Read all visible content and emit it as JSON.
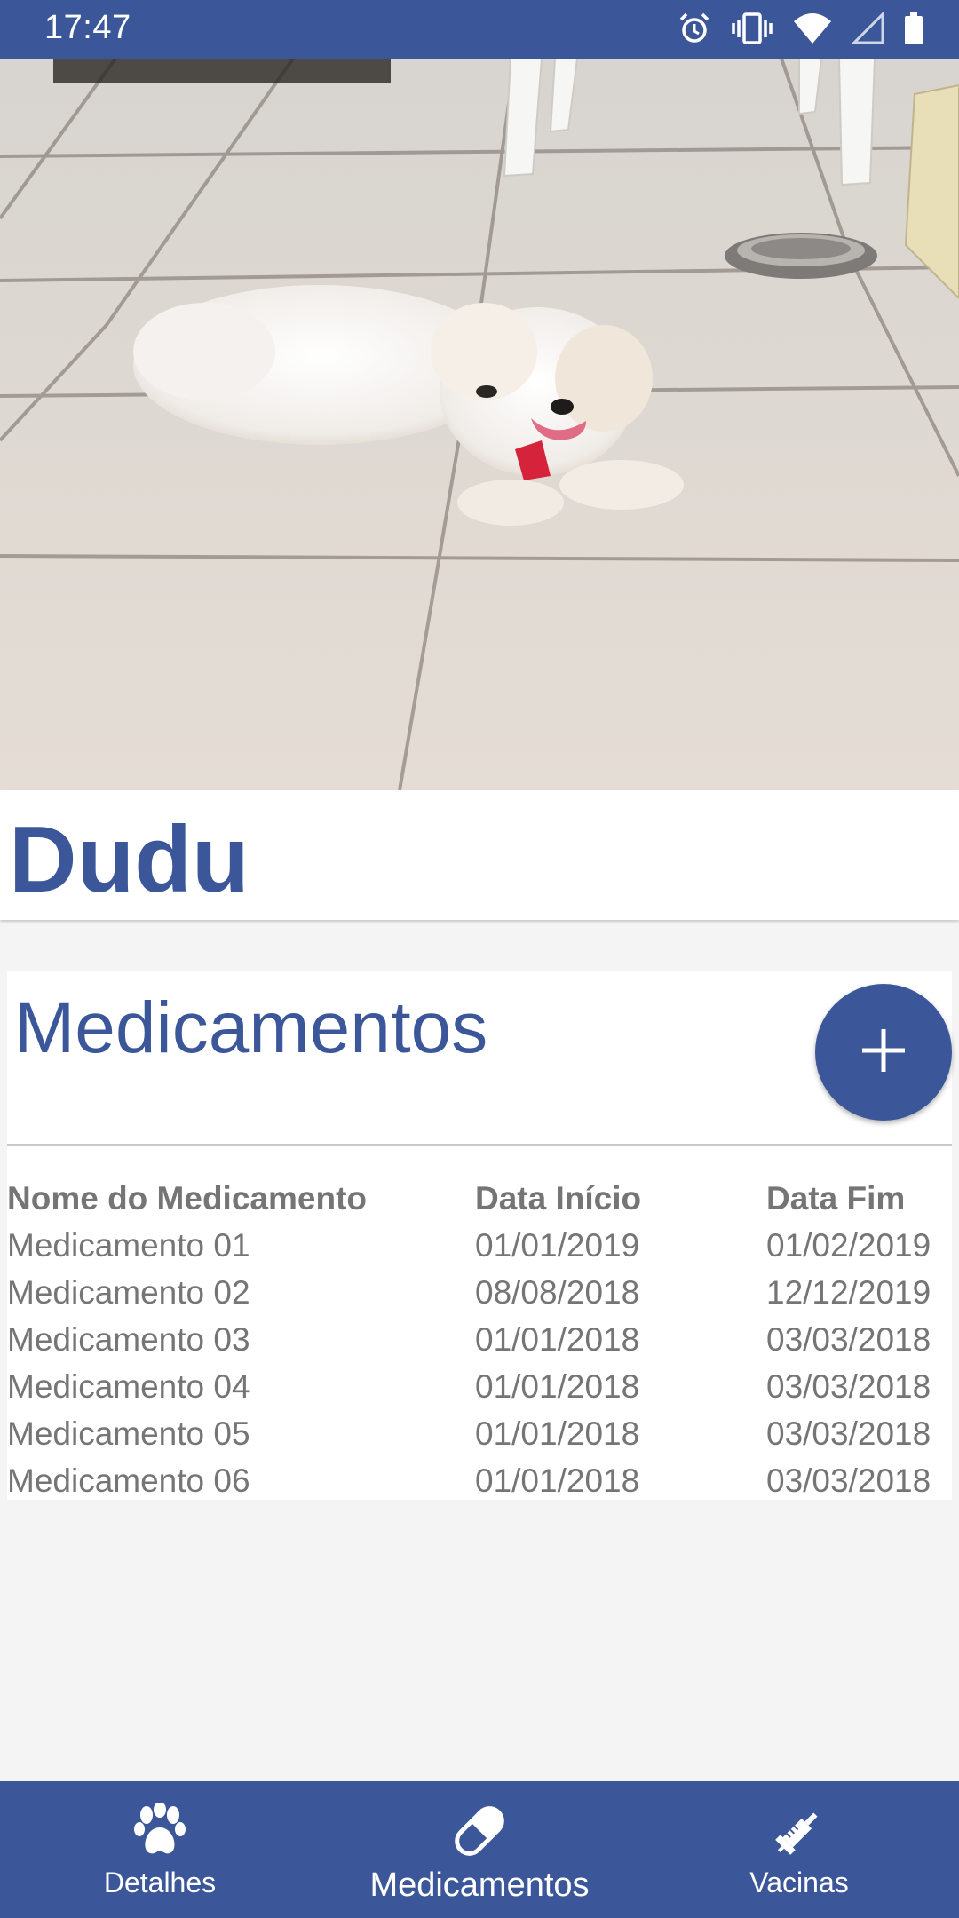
{
  "status_bar": {
    "time": "17:47",
    "icons": [
      "alarm-icon",
      "vibrate-icon",
      "wifi-icon",
      "signal-icon",
      "battery-icon"
    ]
  },
  "pet": {
    "name": "Dudu",
    "photo_icon": "dog-photo"
  },
  "medications": {
    "title": "Medicamentos",
    "add_icon": "plus-icon",
    "columns": [
      "Nome do Medicamento",
      "Data Início",
      "Data Fim"
    ],
    "rows": [
      [
        "Medicamento 01",
        "01/01/2019",
        "01/02/2019"
      ],
      [
        "Medicamento 02",
        "08/08/2018",
        "12/12/2019"
      ],
      [
        "Medicamento 03",
        "01/01/2018",
        "03/03/2018"
      ],
      [
        "Medicamento 04",
        "01/01/2018",
        "03/03/2018"
      ],
      [
        "Medicamento 05",
        "01/01/2018",
        "03/03/2018"
      ],
      [
        "Medicamento 06",
        "01/01/2018",
        "03/03/2018"
      ]
    ]
  },
  "bottom_nav": {
    "items": [
      {
        "label": "Detalhes",
        "icon": "paw-icon"
      },
      {
        "label": "Medicamentos",
        "icon": "pill-icon",
        "active": true
      },
      {
        "label": "Vacinas",
        "icon": "syringe-icon"
      }
    ]
  },
  "colors": {
    "primary": "#3b579a",
    "background": "#f4f4f4",
    "table_text": "#757575"
  }
}
